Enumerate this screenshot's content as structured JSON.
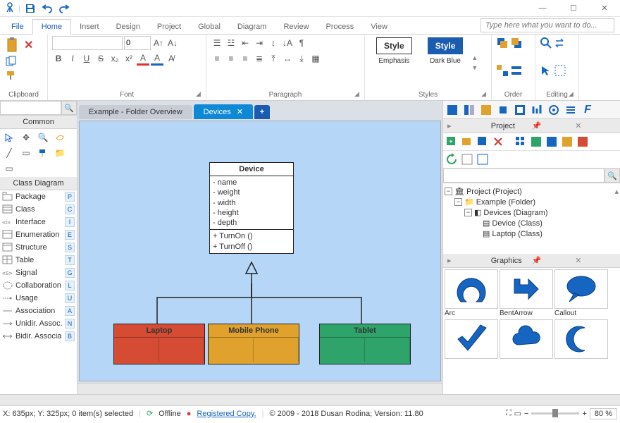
{
  "quick_access": {
    "save_tip": "Save",
    "undo_tip": "Undo",
    "redo_tip": "Redo"
  },
  "window": {
    "min": "—",
    "max": "☐",
    "close": "✕"
  },
  "menu": {
    "file": "File",
    "home": "Home",
    "insert": "Insert",
    "design": "Design",
    "project": "Project",
    "global": "Global",
    "diagram": "Diagram",
    "review": "Review",
    "process": "Process",
    "view": "View",
    "tellme_placeholder": "Type here what you want to do..."
  },
  "ribbon": {
    "clipboard": {
      "label": "Clipboard"
    },
    "font": {
      "label": "Font",
      "name": "",
      "size": "0",
      "bold": "B",
      "italic": "I",
      "underline": "U",
      "strike": "S"
    },
    "paragraph": {
      "label": "Paragraph"
    },
    "styles": {
      "label": "Styles",
      "style1_btn": "Style",
      "style1_label": "Emphasis",
      "style2_btn": "Style",
      "style2_label": "Dark Blue"
    },
    "order": {
      "label": "Order"
    },
    "editing": {
      "label": "Editing"
    }
  },
  "leftpanel": {
    "common": "Common",
    "class_diagram": "Class Diagram",
    "items": [
      {
        "label": "Package",
        "key": "P"
      },
      {
        "label": "Class",
        "key": "C"
      },
      {
        "label": "Interface",
        "key": "I"
      },
      {
        "label": "Enumeration",
        "key": "E"
      },
      {
        "label": "Structure",
        "key": "S"
      },
      {
        "label": "Table",
        "key": "T"
      },
      {
        "label": "Signal",
        "key": "G"
      },
      {
        "label": "Collaboration",
        "key": "L"
      },
      {
        "label": "Usage",
        "key": "U"
      },
      {
        "label": "Association",
        "key": "A"
      },
      {
        "label": "Unidir. Assoc.",
        "key": "N"
      },
      {
        "label": "Bidir. Associa",
        "key": "B"
      }
    ]
  },
  "tabs": {
    "tab1": "Example - Folder Overview",
    "tab2": "Devices",
    "close": "✕"
  },
  "diagram": {
    "device": {
      "name": "Device",
      "attr1": "- name",
      "attr2": "- weight",
      "attr3": "- width",
      "attr4": "- height",
      "attr5": "- depth",
      "op1": "+ TurnOn ()",
      "op2": "+ TurnOff ()"
    },
    "laptop": "Laptop",
    "mobile": "Mobile Phone",
    "tablet": "Tablet"
  },
  "rightpanel": {
    "project": "Project",
    "graphics": "Graphics",
    "tree": {
      "n1": "Project (Project)",
      "n2": "Example (Folder)",
      "n3": "Devices (Diagram)",
      "n4": "Device (Class)",
      "n5": "Laptop (Class)"
    },
    "shapes": {
      "arc": "Arc",
      "bentarrow": "BentArrow",
      "callout": "Callout"
    }
  },
  "status": {
    "coords": "X: 635px; Y: 325px; 0 item(s) selected",
    "offline": "Offline",
    "registered": "Registered Copy.",
    "copyright": "© 2009 - 2018 Dusan Rodina; Version: 11.80",
    "zoom": "80 %"
  },
  "colors": {
    "laptop": "#d64b33",
    "mobile": "#e0a22c",
    "tablet": "#2ea36a",
    "accent": "#1665c0"
  }
}
